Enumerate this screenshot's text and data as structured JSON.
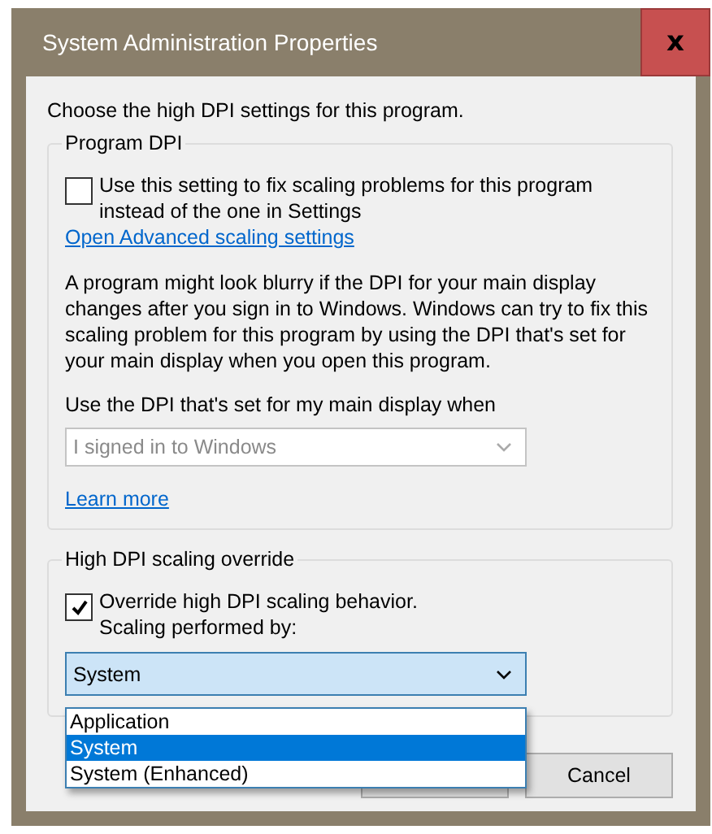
{
  "window": {
    "title": "System Administration Properties",
    "close_glyph": "x"
  },
  "intro": "Choose the high DPI settings for this program.",
  "program_dpi": {
    "title": "Program DPI",
    "checkbox": {
      "label": "Use this setting to fix scaling problems for this program instead of the one in Settings",
      "checked": false
    },
    "link": "Open Advanced scaling settings",
    "description": "A program might look blurry if the DPI for your main display changes after you sign in to Windows. Windows can try to fix this scaling problem for this program by using the DPI that's set for your main display when you open this program.",
    "combo_label": "Use the DPI that's set for my main display when",
    "combo": {
      "value": "I signed in to Windows",
      "disabled": true
    },
    "learn_more": "Learn more"
  },
  "override": {
    "title": "High DPI scaling override",
    "checkbox": {
      "label": "Override high DPI scaling behavior. Scaling performed by:",
      "checked": true
    },
    "combo": {
      "value": "System",
      "expanded": true,
      "options": [
        {
          "label": "Application",
          "selected": false
        },
        {
          "label": "System",
          "selected": true
        },
        {
          "label": "System (Enhanced)",
          "selected": false
        }
      ]
    }
  },
  "buttons": [
    {
      "label": "Cancel"
    }
  ]
}
